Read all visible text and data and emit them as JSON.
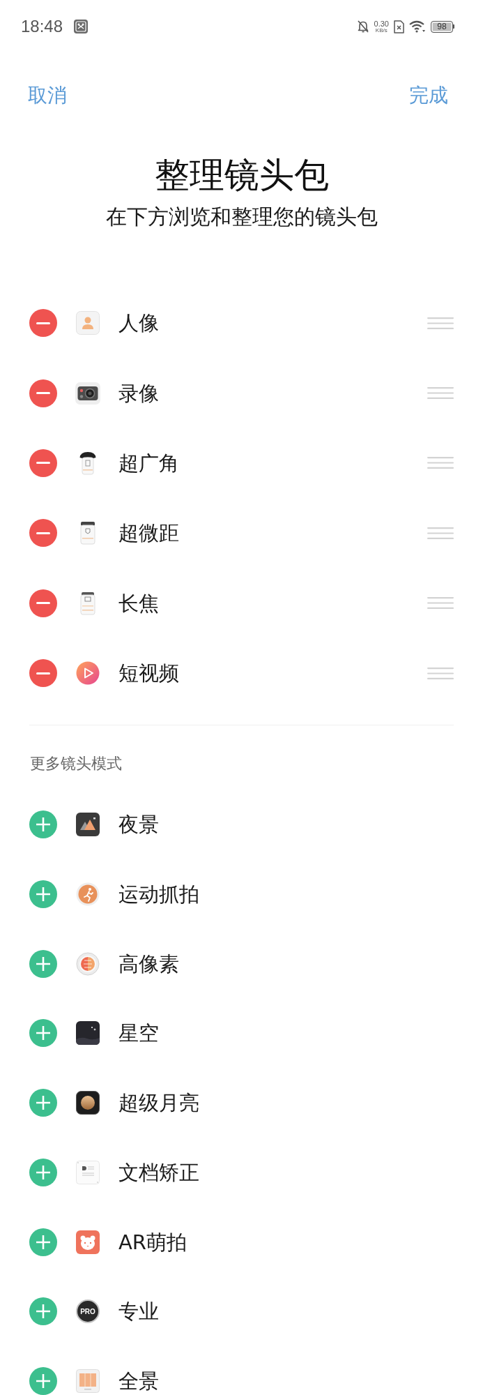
{
  "status_bar": {
    "time": "18:48",
    "net_speed": "0.30",
    "net_unit": "KB/s",
    "battery": "98"
  },
  "nav": {
    "cancel": "取消",
    "done": "完成"
  },
  "header": {
    "title": "整理镜头包",
    "subtitle": "在下方浏览和整理您的镜头包"
  },
  "sections": [
    {
      "kind": "current",
      "items": [
        {
          "label": "人像"
        },
        {
          "label": "录像"
        },
        {
          "label": "超广角"
        },
        {
          "label": "超微距"
        },
        {
          "label": "长焦"
        },
        {
          "label": "短视频"
        }
      ]
    },
    {
      "kind": "more",
      "heading": "更多镜头模式",
      "items": [
        {
          "label": "夜景"
        },
        {
          "label": "运动抓拍"
        },
        {
          "label": "高像素"
        },
        {
          "label": "星空"
        },
        {
          "label": "超级月亮"
        },
        {
          "label": "文档矫正"
        },
        {
          "label": "AR萌拍"
        },
        {
          "label": "专业",
          "icon_text": "PRO"
        },
        {
          "label": "全景"
        }
      ]
    }
  ]
}
